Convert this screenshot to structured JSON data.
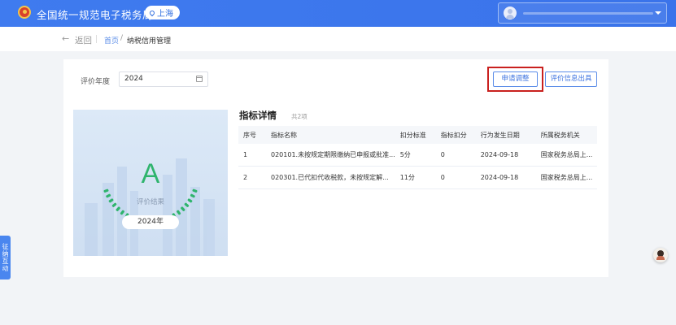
{
  "header": {
    "site_title": "全国统一规范电子税务局",
    "region": "上海",
    "user_name": ""
  },
  "subbar": {
    "back_label": "返回",
    "breadcrumb_home": "首页",
    "breadcrumb_sep": "/",
    "breadcrumb_current": "纳税信用管理"
  },
  "filter": {
    "year_label": "评价年度",
    "year_value": "2024"
  },
  "actions": {
    "apply_label": "申请调整",
    "issue_label": "评价信息出具"
  },
  "grade": {
    "letter": "A",
    "caption": "评价结果",
    "year_badge": "2024年"
  },
  "detail": {
    "title": "指标详情",
    "count": "共2项",
    "columns": [
      "序号",
      "指标名称",
      "扣分标准",
      "指标扣分",
      "行为发生日期",
      "所属税务机关"
    ],
    "rows": [
      [
        "1",
        "020101.未按规定期限缴纳已申报或批准...",
        "5分",
        "0",
        "2024-09-18",
        "国家税务总局上..."
      ],
      [
        "2",
        "020301.已代扣代收税款，未按规定解...",
        "11分",
        "0",
        "2024-09-18",
        "国家税务总局上..."
      ]
    ]
  },
  "side": {
    "tab_label": "征纳互动"
  },
  "colors": {
    "header_blue": "#3f7bef",
    "grade_green": "#2fb46d",
    "highlight_red": "#c9201e"
  }
}
